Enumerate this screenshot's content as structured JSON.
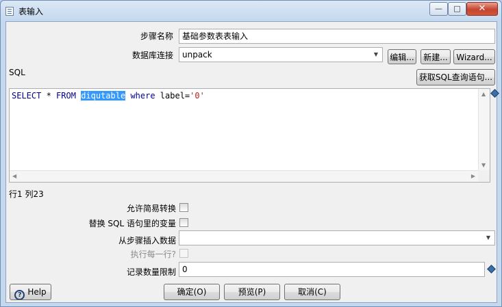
{
  "window": {
    "title": "表输入",
    "min_glyph": "—",
    "max_glyph": "□",
    "close_glyph": "✕"
  },
  "form": {
    "step_name_label": "步骤名称",
    "step_name_value": "基础参数表表输入",
    "db_connection_label": "数据库连接",
    "db_connection_value": "unpack",
    "edit_button": "编辑...",
    "new_button": "新建...",
    "wizard_button": "Wizard...",
    "sql_label": "SQL",
    "get_sql_button": "获取SQL查询语句...",
    "sql": {
      "select_kw": "SELECT",
      "star": " * ",
      "from_kw": "FROM",
      "table": "diqutable",
      "where_kw": "where",
      "condition": " label=",
      "literal": "'0'"
    },
    "cursor_position": "行1 列23",
    "lazy_conversion_label": "允许简易转换",
    "replace_vars_label": "替换 SQL 语句里的变量",
    "insert_from_step_label": "从步骤插入数据",
    "insert_from_step_value": "",
    "execute_each_row_label": "执行每一行?",
    "limit_label": "记录数量限制",
    "limit_value": "0"
  },
  "buttons": {
    "help": "Help",
    "ok": "确定(O)",
    "preview": "预览(P)",
    "cancel": "取消(C)"
  },
  "colors": {
    "selection": "#3399ff",
    "keyword": "#00008b",
    "string_literal": "#b22222",
    "close_button": "#c7442d"
  }
}
